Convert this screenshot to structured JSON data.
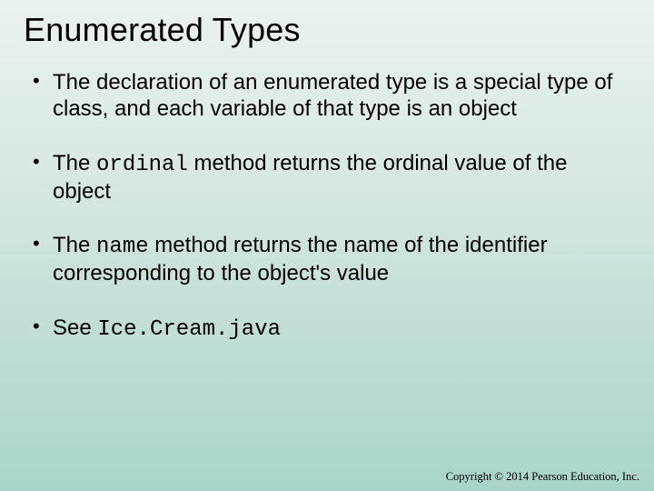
{
  "title": "Enumerated Types",
  "bullets": [
    {
      "segments": [
        {
          "text": "The declaration of an enumerated type is a special type of class, and each variable of that type is an object",
          "code": false
        }
      ]
    },
    {
      "segments": [
        {
          "text": "The ",
          "code": false
        },
        {
          "text": "ordinal",
          "code": true
        },
        {
          "text": " method returns the ordinal value of the object",
          "code": false
        }
      ]
    },
    {
      "segments": [
        {
          "text": "The ",
          "code": false
        },
        {
          "text": "name",
          "code": true
        },
        {
          "text": " method returns the name of the identifier corresponding to the object's value",
          "code": false
        }
      ]
    },
    {
      "segments": [
        {
          "text": "See ",
          "code": false
        },
        {
          "text": "Ice.Cream.java",
          "code": true
        }
      ]
    }
  ],
  "footer": "Copyright © 2014 Pearson Education, Inc."
}
